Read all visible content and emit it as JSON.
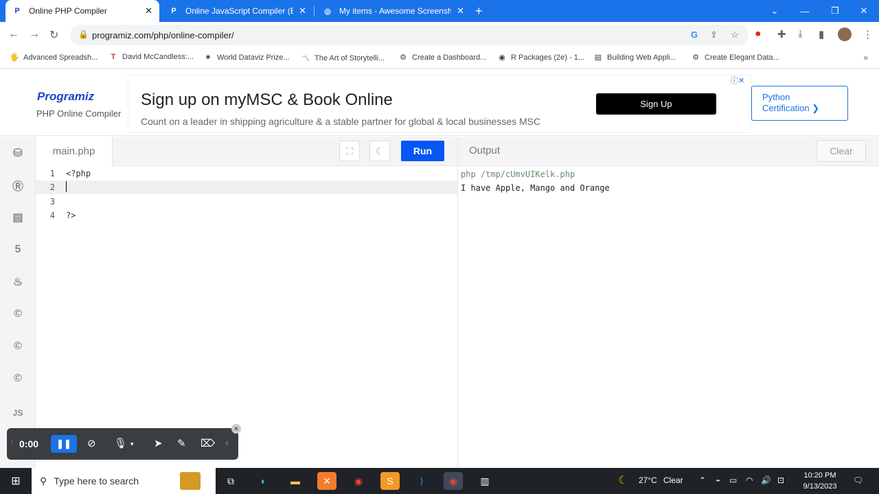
{
  "browser": {
    "tabs": [
      {
        "title": "Online PHP Compiler",
        "active": true
      },
      {
        "title": "Online JavaScript Compiler (Edit",
        "active": false
      },
      {
        "title": "My items - Awesome Screenshot",
        "active": false
      }
    ],
    "url": "programiz.com/php/online-compiler/",
    "bookmarks": [
      {
        "label": "Advanced Spreadsh..."
      },
      {
        "label": "David McCandless:..."
      },
      {
        "label": "World Dataviz Prize..."
      },
      {
        "label": "The Art of Storytelli..."
      },
      {
        "label": "Create a Dashboard..."
      },
      {
        "label": "R Packages (2e) - 1..."
      },
      {
        "label": "Building Web Appli..."
      },
      {
        "label": "Create Elegant Data..."
      }
    ]
  },
  "site": {
    "logo": "Programiz",
    "subtitle": "PHP Online Compiler",
    "ad": {
      "title": "Sign up on myMSC & Book Online",
      "text": "Count on a leader in shipping agriculture & a stable partner for global & local businesses MSC",
      "button": "Sign Up"
    },
    "cert_button_line1": "Python",
    "cert_button_line2": "Certification ❯"
  },
  "editor": {
    "file_name": "main.php",
    "run_label": "Run",
    "lines": [
      {
        "num": "1",
        "code": "<?php"
      },
      {
        "num": "2",
        "code": ""
      },
      {
        "num": "3",
        "code": ""
      },
      {
        "num": "4",
        "code": "?>"
      }
    ]
  },
  "output": {
    "title": "Output",
    "clear_label": "Clear",
    "command": "php /tmp/cUmvUIKelk.php",
    "result": "I have Apple, Mango and Orange"
  },
  "recorder": {
    "time": "0:00"
  },
  "taskbar": {
    "search_placeholder": "Type here to search",
    "weather_temp": "27°C",
    "weather_desc": "Clear",
    "time": "10:20 PM",
    "date": "9/13/2023"
  },
  "colors": {
    "chrome_blue": "#1a73e8",
    "run_button": "#0556f3",
    "programiz_logo": "#1a44c8"
  }
}
